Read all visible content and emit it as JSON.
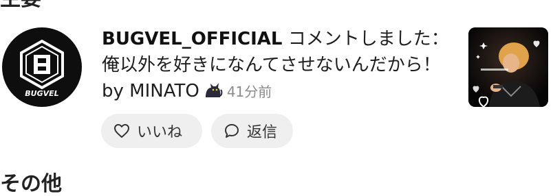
{
  "sections": {
    "top": "主要",
    "other": "その他"
  },
  "notification": {
    "user_name": "BUGVEL_OFFICIAL",
    "action_text": " コメントしました：",
    "comment_text": "俺以外を好きになんてさせないんだから！ by MINATO",
    "time_ago": "41分前",
    "avatar_text": "BUGVEL",
    "actions": {
      "like_label": "いいね",
      "reply_label": "返信"
    }
  },
  "colors": {
    "avatar_bg": "#0e0e0e",
    "pill_bg": "#efefef",
    "muted_text": "#8a8a8a"
  },
  "icons": [
    "heart-icon",
    "speech-bubble-icon",
    "black-cat-icon"
  ]
}
